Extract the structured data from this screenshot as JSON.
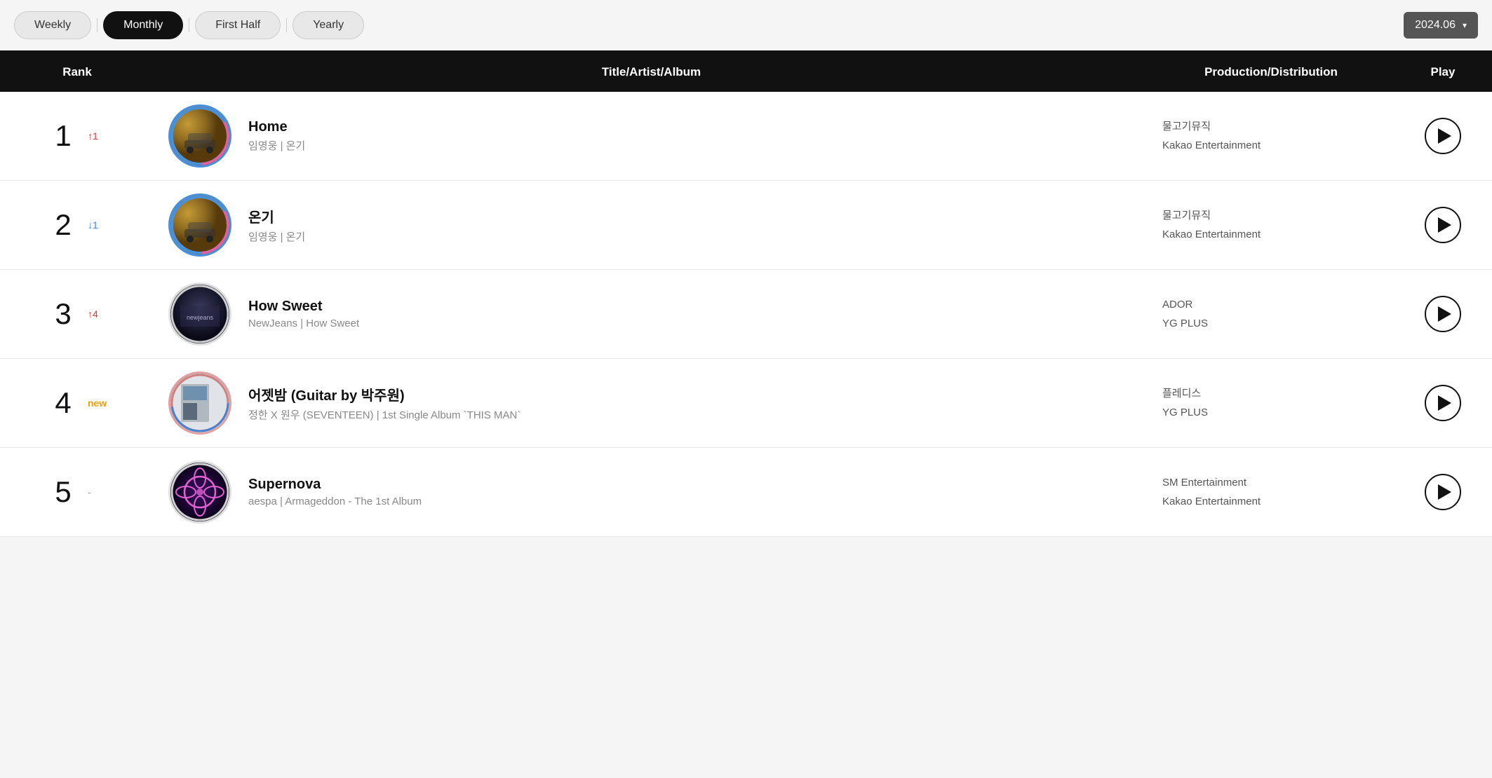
{
  "tabs": [
    {
      "id": "weekly",
      "label": "Weekly",
      "active": false
    },
    {
      "id": "monthly",
      "label": "Monthly",
      "active": true
    },
    {
      "id": "first-half",
      "label": "First Half",
      "active": false
    },
    {
      "id": "yearly",
      "label": "Yearly",
      "active": false
    }
  ],
  "date_selector": {
    "label": "2024.06",
    "chevron": "▾"
  },
  "table": {
    "headers": {
      "rank": "Rank",
      "title_artist_album": "Title/Artist/Album",
      "production_distribution": "Production/Distribution",
      "play": "Play"
    },
    "rows": [
      {
        "rank": "1",
        "rank_change": "↑1",
        "rank_change_type": "up",
        "song_title": "Home",
        "song_meta": "임영웅 | 온기",
        "production": "물고기뮤직",
        "distribution": "Kakao Entertainment",
        "art_type": "1"
      },
      {
        "rank": "2",
        "rank_change": "↓1",
        "rank_change_type": "down",
        "song_title": "온기",
        "song_meta": "임영웅 | 온기",
        "production": "물고기뮤직",
        "distribution": "Kakao Entertainment",
        "art_type": "2"
      },
      {
        "rank": "3",
        "rank_change": "↑4",
        "rank_change_type": "up",
        "song_title": "How Sweet",
        "song_meta": "NewJeans | How Sweet",
        "production": "ADOR",
        "distribution": "YG PLUS",
        "art_type": "3"
      },
      {
        "rank": "4",
        "rank_change": "new",
        "rank_change_type": "new",
        "song_title": "어젯밤 (Guitar by 박주원)",
        "song_meta": "정한 X 원우 (SEVENTEEN) | 1st Single Album `THIS MAN`",
        "production": "플레디스",
        "distribution": "YG PLUS",
        "art_type": "4"
      },
      {
        "rank": "5",
        "rank_change": "-",
        "rank_change_type": "neutral",
        "song_title": "Supernova",
        "song_meta": "aespa | Armageddon - The 1st Album",
        "production": "SM Entertainment",
        "distribution": "Kakao Entertainment",
        "art_type": "5"
      }
    ]
  }
}
